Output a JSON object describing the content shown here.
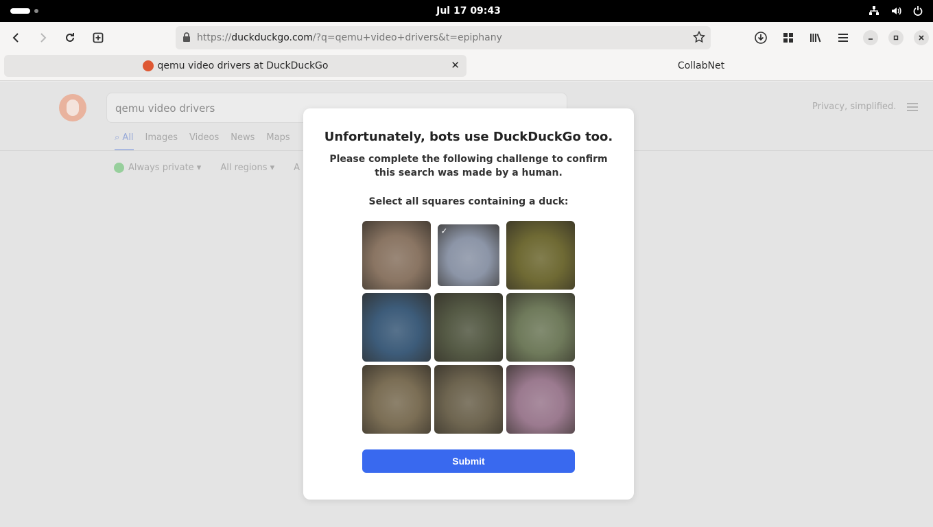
{
  "system_bar": {
    "clock": "Jul 17  09:43",
    "icons": [
      "network-icon",
      "volume-icon",
      "power-icon"
    ]
  },
  "toolbar": {
    "url_host": "duckduckgo.com",
    "url_prefix": "https://",
    "url_rest": "/?q=qemu+video+drivers&t=epiphany",
    "icons": [
      "back-icon",
      "forward-icon",
      "reload-icon",
      "new-tab-icon",
      "lock-icon",
      "star-icon",
      "download-icon",
      "grid-icon",
      "library-icon",
      "menu-icon",
      "minimize-icon",
      "maximize-icon",
      "close-icon"
    ]
  },
  "tabs": [
    {
      "title": "qemu video drivers at DuckDuckGo",
      "active": true
    },
    {
      "title": "CollabNet",
      "active": false
    }
  ],
  "page": {
    "search_query": "qemu video drivers",
    "nav": [
      "All",
      "Images",
      "Videos",
      "News",
      "Maps"
    ],
    "filters": [
      "Always private ▾",
      "All regions ▾",
      "A"
    ],
    "tagline": "Privacy, simplified."
  },
  "modal": {
    "title": "Unfortunately, bots use DuckDuckGo too.",
    "subtitle": "Please complete the following challenge to confirm this search was made by a human.",
    "instruction": "Select all squares containing a duck:",
    "tiles": [
      {
        "icon": "leopard-cat-image",
        "selected": false,
        "color": "#8a7563"
      },
      {
        "icon": "flamingo-image",
        "selected": true,
        "color": "#8c95a7"
      },
      {
        "icon": "monkey-image",
        "selected": false,
        "color": "#6f6a34"
      },
      {
        "icon": "duck-water-image",
        "selected": false,
        "color": "#3d5c7a"
      },
      {
        "icon": "koala-image",
        "selected": false,
        "color": "#555a45"
      },
      {
        "icon": "squirrel-image",
        "selected": false,
        "color": "#6f7a5b"
      },
      {
        "icon": "deer-image",
        "selected": false,
        "color": "#7b6e55"
      },
      {
        "icon": "duck-image",
        "selected": false,
        "color": "#6e6550"
      },
      {
        "icon": "cats-lavender-image",
        "selected": false,
        "color": "#9b7a8f"
      }
    ],
    "submit_label": "Submit"
  }
}
